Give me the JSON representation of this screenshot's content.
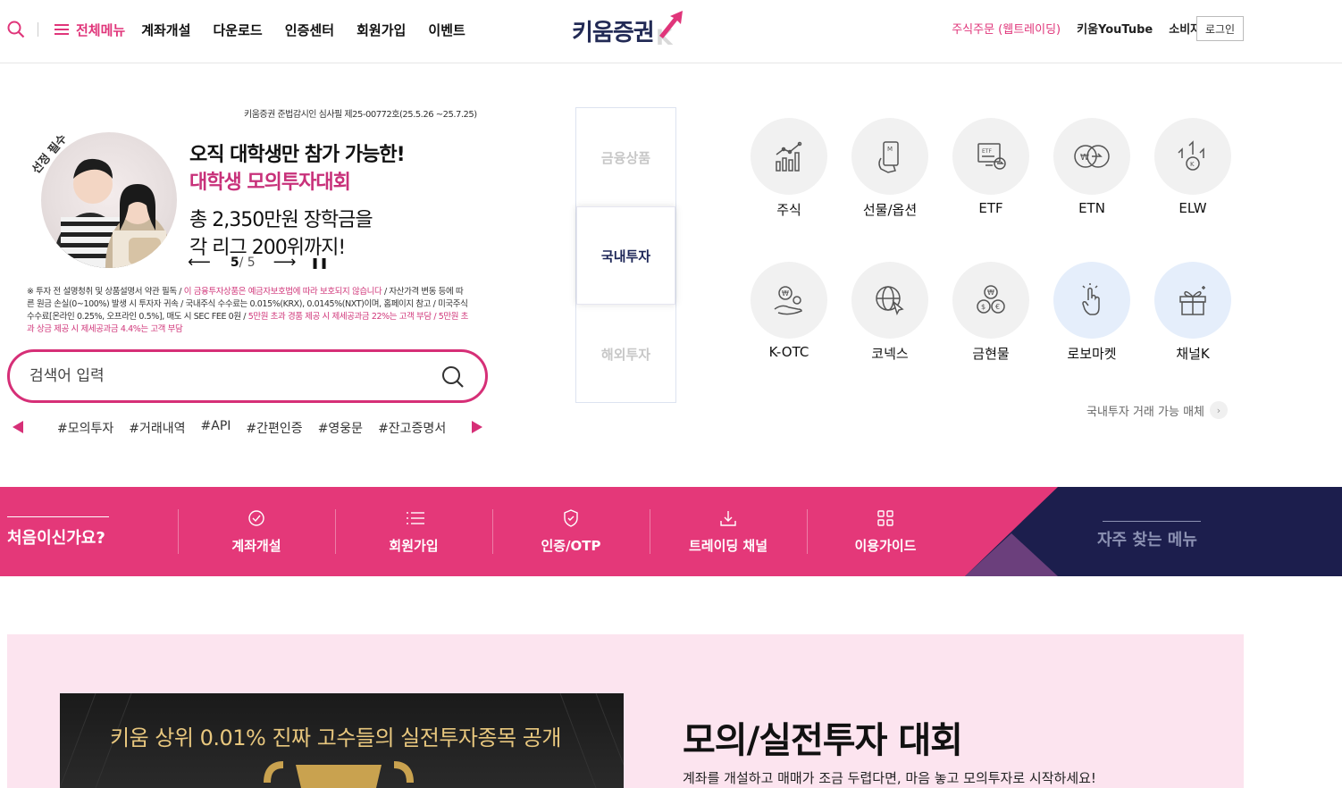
{
  "header": {
    "all_menu": "전체메뉴",
    "nav": [
      "계좌개설",
      "다운로드",
      "인증센터",
      "회원가입",
      "이벤트"
    ],
    "logo": "키움증권",
    "right_links": [
      "주식주문 (웹트레이딩)",
      "키움YouTube",
      "소비자보호포탈"
    ],
    "login": "로그인"
  },
  "banner": {
    "notice": "키움증권 준법감시인 심사필 제25-00772호(25.5.26 ~25.7.25)",
    "badge": "선정 필수",
    "line1": "오직 대학생만 참가 가능한!",
    "line2": "대학생 모의투자대회",
    "line3": "총 2,350만원 장학금을",
    "line4": "각 리그 200위까지!",
    "page_current": "5",
    "page_total": "/ 5",
    "disclaimer_a": "※ 투자 전 설명청취 및 상품설명서 약관 필독 / ",
    "disclaimer_b": "이 금융투자상품은 예금자보호법에 따라 보호되지 않습니다",
    "disclaimer_c": " / 자산가격 변동 등에 따른 원금 손실(0~100%) 발생 시 투자자 귀속 / 국내주식 수수료는 0.015%(KRX), 0.0145%(NXT)이며, 홈페이지 참고 / 미국주식 수수료[온라인 0.25%, 오프라인 0.5%], 매도 시 SEC FEE 0원 / ",
    "disclaimer_d": "5만원 초과 경품 제공 시 제세공과금 22%는 고객 부담 / 5만원 초과 상금 제공 시 제세공과금 4.4%는 고객 부담"
  },
  "search": {
    "placeholder": "검색어 입력",
    "tags": [
      "#모의투자",
      "#거래내역",
      "#API",
      "#간편인증",
      "#영웅문",
      "#잔고증명서"
    ]
  },
  "product_tabs": [
    "금융상품",
    "국내투자",
    "해외투자"
  ],
  "products": [
    {
      "label": "주식",
      "icon": "chart-icon"
    },
    {
      "label": "선물/옵션",
      "icon": "mobile-hand-icon"
    },
    {
      "label": "ETF",
      "icon": "etf-monitor-icon"
    },
    {
      "label": "ETN",
      "icon": "won-exchange-icon"
    },
    {
      "label": "ELW",
      "icon": "coin-arrows-icon"
    },
    {
      "label": "K-OTC",
      "icon": "hand-coin-icon"
    },
    {
      "label": "코넥스",
      "icon": "globe-cursor-icon"
    },
    {
      "label": "금현물",
      "icon": "coins-icon"
    },
    {
      "label": "로보마켓",
      "icon": "touch-icon"
    },
    {
      "label": "채널K",
      "icon": "gift-icon"
    }
  ],
  "trade_media": "국내투자 거래 가능 매체",
  "band": {
    "title": "처음이신가요?",
    "items": [
      "계좌개설",
      "회원가입",
      "인증/OTP",
      "트레이딩 채널",
      "이용가이드"
    ],
    "frequent": "자주 찾는 메뉴"
  },
  "contest": {
    "banner_text": "키움 상위 0.01% 진짜 고수들의 실전투자종목 공개",
    "title": "모의/실전투자 대회",
    "subtitle": "계좌를 개설하고 매매가 조금 두렵다면, 마음 놓고 모의투자로 시작하세요!"
  },
  "colors": {
    "brand_pink": "#e43879",
    "navy": "#1c1e4d"
  }
}
